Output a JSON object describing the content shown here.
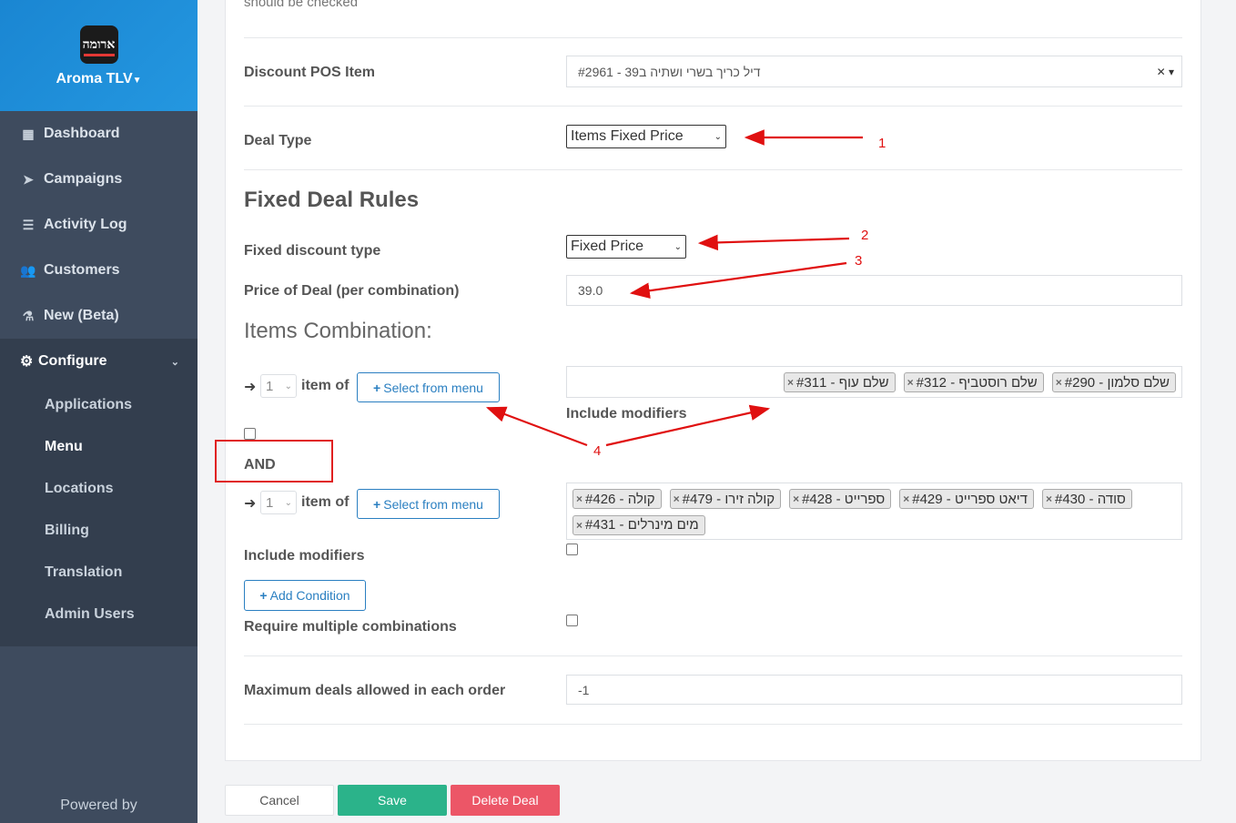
{
  "sidebar": {
    "brand_logo_text": "ארומה",
    "brand_name": "Aroma TLV",
    "items": [
      {
        "label": "Dashboard",
        "icon": "dashboard-icon"
      },
      {
        "label": "Campaigns",
        "icon": "paper-plane-icon"
      },
      {
        "label": "Activity Log",
        "icon": "list-icon"
      },
      {
        "label": "Customers",
        "icon": "users-icon"
      },
      {
        "label": "New (Beta)",
        "icon": "flask-icon"
      }
    ],
    "configure_label": "Configure",
    "submenu": [
      "Applications",
      "Menu",
      "Locations",
      "Billing",
      "Translation",
      "Admin Users"
    ],
    "powered_by": "Powered by"
  },
  "form": {
    "top_text": "should be checked",
    "discount_pos_item_label": "Discount POS Item",
    "discount_pos_item_value": "#2961 - דיל כריך בשרי ושתיה ב39",
    "deal_type_label": "Deal Type",
    "deal_type_value": "Items Fixed Price",
    "section_title": "Fixed Deal Rules",
    "fixed_discount_type_label": "Fixed discount type",
    "fixed_discount_type_value": "Fixed Price",
    "price_label": "Price of Deal (per combination)",
    "price_value": "39.0",
    "items_combination_title": "Items Combination:",
    "item_of_label": "item of",
    "select_from_menu_label": "Select from menu",
    "group1_qty": "1",
    "group1_tags": [
      "#290 - שלם סלמון",
      "#312 - שלם רוסטביף",
      "#311 - שלם עוף"
    ],
    "include_modifiers_label": "Include modifiers",
    "and_label": "AND",
    "group2_qty": "1",
    "group2_tags": [
      "#430 - סודה",
      "#429 - דיאט ספרייט",
      "#428 - ספרייט",
      "#479 - קולה זירו",
      "#426 - קולה",
      "#431 - מים מינרלים"
    ],
    "add_condition_label": "Add Condition",
    "require_multiple_label": "Require multiple combinations",
    "max_deals_label": "Maximum deals allowed in each order",
    "max_deals_value": "-1"
  },
  "buttons": {
    "cancel": "Cancel",
    "save": "Save",
    "delete": "Delete Deal"
  },
  "annotations": [
    "1",
    "2",
    "3",
    "4"
  ]
}
